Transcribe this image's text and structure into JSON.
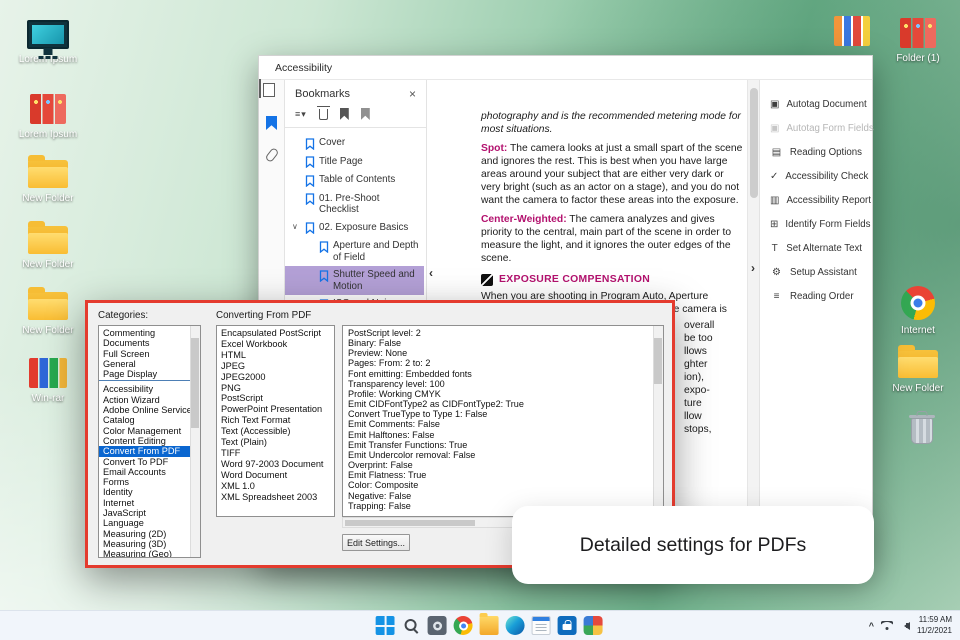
{
  "window": {
    "title": "Accessibility"
  },
  "icons": {
    "close": "×",
    "options": "≡▾",
    "tree_chevron": "∨",
    "collapse_left": "‹",
    "collapse_right": "›",
    "tray_chevron": "^"
  },
  "colors": {
    "accent_magenta": "#b3116e",
    "selection_blue": "#0a66d0",
    "bookmark_selected": "#b3a0d6",
    "annotation_red": "#e43b2e"
  },
  "desktop": {
    "left_icons": [
      {
        "label": "Lorem Ipsum",
        "type": "computer"
      },
      {
        "label": "Lorem Ipsum",
        "type": "binders"
      },
      {
        "label": "New Folder",
        "type": "folder"
      },
      {
        "label": "New Folder",
        "type": "folder"
      },
      {
        "label": "New Folder",
        "type": "folder"
      },
      {
        "label": "Win-rar",
        "type": "winrar"
      }
    ],
    "right_icons": [
      {
        "label": "",
        "type": "palette"
      },
      {
        "label": "Folder (1)",
        "type": "binders"
      },
      {
        "label": "Internet",
        "type": "chrome"
      },
      {
        "label": "New Folder",
        "type": "folder"
      },
      {
        "label": "",
        "type": "trash"
      }
    ]
  },
  "acrobat": {
    "bookmarks": {
      "title": "Bookmarks",
      "items": [
        {
          "label": "Cover",
          "level": 1
        },
        {
          "label": "Title Page",
          "level": 1
        },
        {
          "label": "Table of Contents",
          "level": 1
        },
        {
          "label": "01. Pre-Shoot Checklist",
          "level": 1
        },
        {
          "label": "02. Exposure Basics",
          "level": 1,
          "chevron": true
        },
        {
          "label": "Aperture and Depth of Field",
          "level": 2
        },
        {
          "label": "Shutter Speed and Motion",
          "level": 2,
          "selected": true
        },
        {
          "label": "ISO and Noise",
          "level": 2
        }
      ]
    },
    "document": {
      "intro_italic": "photography and is the recommended metering mode for most situations.",
      "spot_label": "Spot:",
      "spot_text": " The camera looks at just a small spart of the scene and ignores the rest. This is best when you have large areas around your subject that are either very dark or very bright (such as an actor on a stage), and you do not want the camera to factor these areas into the exposure.",
      "cw_label": "Center-Weighted:",
      "cw_text": " The camera analyzes and gives priority to the central, main part of the scene in order to measure the light, and it ignores the outer edges of the scene.",
      "heading": "EXPOSURE COMPENSATION",
      "body": "When you are shooting in Program Auto, Aperture Priority, or Shutter Speed Priority mode, the camera is determining or",
      "clipped_lines": [
        "overall",
        "be too",
        "llows",
        "ghter",
        "ion),",
        "expo-",
        "ture",
        "llow",
        "stops,"
      ]
    },
    "tools": [
      {
        "label": "Autotag Document",
        "glyph": "▣"
      },
      {
        "label": "Autotag Form Fields",
        "glyph": "▣",
        "disabled": true
      },
      {
        "label": "Reading Options",
        "glyph": "▤"
      },
      {
        "label": "Accessibility Check",
        "glyph": "✓"
      },
      {
        "label": "Accessibility Report",
        "glyph": "▥"
      },
      {
        "label": "Identify Form Fields",
        "glyph": "⊞"
      },
      {
        "label": "Set Alternate Text",
        "glyph": "T"
      },
      {
        "label": "Setup Assistant",
        "glyph": "⚙"
      },
      {
        "label": "Reading Order",
        "glyph": "≡"
      }
    ]
  },
  "preferences": {
    "categories_label": "Categories:",
    "section_label": "Converting From PDF",
    "categories": [
      {
        "label": "Commenting"
      },
      {
        "label": "Documents"
      },
      {
        "label": "Full Screen"
      },
      {
        "label": "General"
      },
      {
        "label": "Page Display",
        "divider": true
      },
      {
        "label": "Accessibility"
      },
      {
        "label": "Action Wizard"
      },
      {
        "label": "Adobe Online Services"
      },
      {
        "label": "Catalog"
      },
      {
        "label": "Color Management"
      },
      {
        "label": "Content Editing"
      },
      {
        "label": "Convert From PDF",
        "selected": true
      },
      {
        "label": "Convert To PDF"
      },
      {
        "label": "Email Accounts"
      },
      {
        "label": "Forms"
      },
      {
        "label": "Identity"
      },
      {
        "label": "Internet"
      },
      {
        "label": "JavaScript"
      },
      {
        "label": "Language"
      },
      {
        "label": "Measuring (2D)"
      },
      {
        "label": "Measuring (3D)"
      },
      {
        "label": "Measuring (Geo)"
      }
    ],
    "formats": [
      "Encapsulated PostScript",
      "Excel Workbook",
      "HTML",
      "JPEG",
      "JPEG2000",
      "PNG",
      "PostScript",
      "PowerPoint Presentation",
      "Rich Text Format",
      "Text (Accessible)",
      "Text (Plain)",
      "TIFF",
      "Word 97-2003 Document",
      "Word Document",
      "XML 1.0",
      "XML Spreadsheet 2003"
    ],
    "settings": [
      "PostScript level: 2",
      "Binary: False",
      "Preview: None",
      "Pages: From: 2 to: 2",
      "Font emitting: Embedded fonts",
      "Transparency level: 100",
      "Profile: Working CMYK",
      "Emit CIDFontType2 as CIDFontType2: True",
      "Convert TrueType to Type 1: False",
      "Emit Comments: False",
      "Emit Halftones: False",
      "Emit Transfer Functions: True",
      "Emit Undercolor removal: False",
      "Overprint: False",
      "Emit Flatness: True",
      "Color: Composite",
      "Negative: False",
      "Trapping: False"
    ],
    "edit_button": "Edit Settings..."
  },
  "callout": {
    "text": "Detailed settings for PDFs"
  },
  "taskbar": {
    "apps": [
      {
        "type": "start"
      },
      {
        "type": "search"
      },
      {
        "type": "camera"
      },
      {
        "type": "chrome"
      },
      {
        "type": "explorer"
      },
      {
        "type": "edge"
      },
      {
        "type": "notepad"
      },
      {
        "type": "store"
      },
      {
        "type": "photos"
      }
    ],
    "tray": {
      "time": "11:59 AM",
      "date": "11/2/2021"
    }
  }
}
